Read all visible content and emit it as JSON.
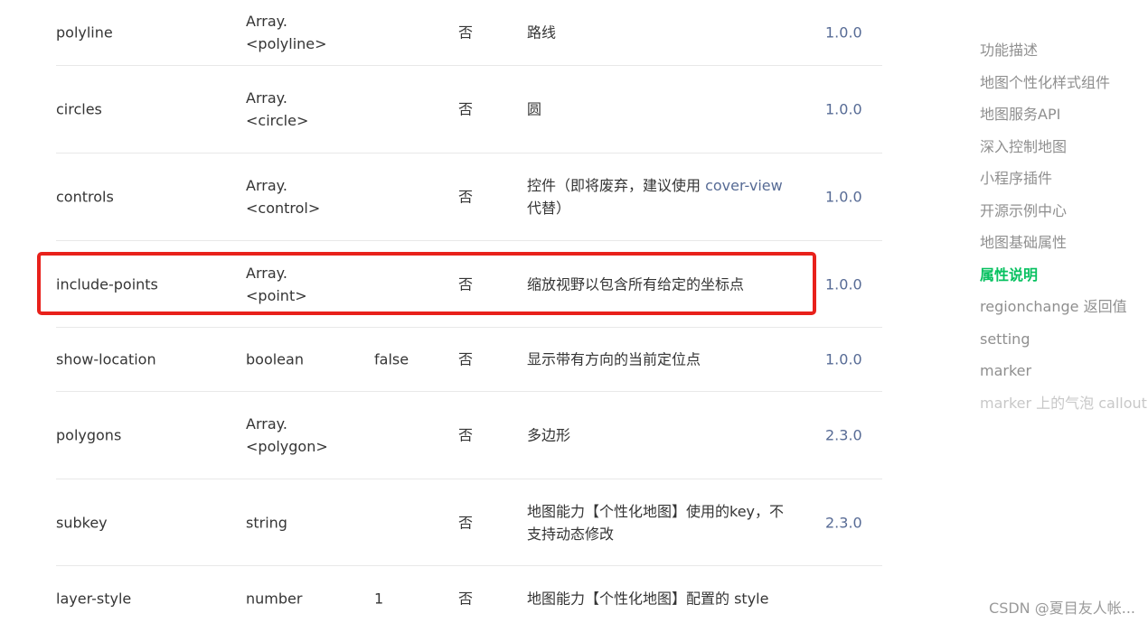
{
  "table": {
    "rows": [
      {
        "attr": "polyline",
        "type": [
          "Array.",
          "<polyline>"
        ],
        "default": "",
        "required": "否",
        "desc": "路线",
        "desc_link": "",
        "desc_after": "",
        "version": "1.0.0"
      },
      {
        "attr": "circles",
        "type": [
          "Array.",
          "<circle>"
        ],
        "default": "",
        "required": "否",
        "desc": "圆",
        "desc_link": "",
        "desc_after": "",
        "version": "1.0.0"
      },
      {
        "attr": "controls",
        "type": [
          "Array.",
          "<control>"
        ],
        "default": "",
        "required": "否",
        "desc": "控件（即将废弃，建议使用 ",
        "desc_link": "cover-view",
        "desc_after": " 代替）",
        "version": "1.0.0"
      },
      {
        "attr": "include-points",
        "type": [
          "Array.",
          "<point>"
        ],
        "default": "",
        "required": "否",
        "desc": "缩放视野以包含所有给定的坐标点",
        "desc_link": "",
        "desc_after": "",
        "version": "1.0.0"
      },
      {
        "attr": "show-location",
        "type": [
          "boolean"
        ],
        "default": "false",
        "required": "否",
        "desc": "显示带有方向的当前定位点",
        "desc_link": "",
        "desc_after": "",
        "version": "1.0.0"
      },
      {
        "attr": "polygons",
        "type": [
          "Array.",
          "<polygon>"
        ],
        "default": "",
        "required": "否",
        "desc": "多边形",
        "desc_link": "",
        "desc_after": "",
        "version": "2.3.0"
      },
      {
        "attr": "subkey",
        "type": [
          "string"
        ],
        "default": "",
        "required": "否",
        "desc": "地图能力【个性化地图】使用的key，不支持动态修改",
        "desc_link": "",
        "desc_after": "",
        "version": "2.3.0"
      },
      {
        "attr": "layer-style",
        "type": [
          "number"
        ],
        "default": "1",
        "required": "否",
        "desc": "地图能力【个性化地图】配置的 style",
        "desc_link": "",
        "desc_after": "",
        "version": ""
      }
    ]
  },
  "toc": {
    "items": [
      "功能描述",
      "地图个性化样式组件",
      "地图服务API",
      "深入控制地图",
      "小程序插件",
      "开源示例中心",
      "地图基础属性",
      "属性说明",
      "regionchange 返回值",
      "setting",
      "marker",
      "marker 上的气泡 callout"
    ],
    "active": "属性说明"
  },
  "watermark": "CSDN @夏目友人帐...",
  "colors": {
    "active": "#07c160",
    "link": "#576b95",
    "highlight": "#e8211b"
  }
}
